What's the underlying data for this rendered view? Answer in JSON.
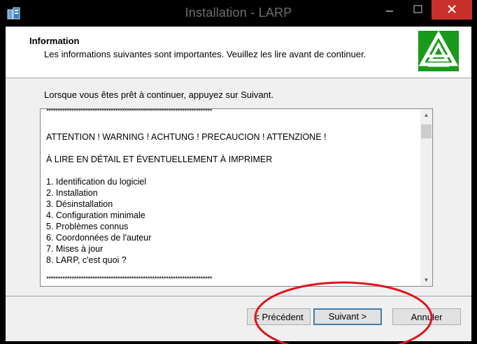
{
  "window": {
    "title": "Installation - LARP"
  },
  "header": {
    "title": "Information",
    "subtitle": "Les informations suivantes sont importantes. Veuillez les lire avant de continuer."
  },
  "body": {
    "instruction": "Lorsque vous êtes prêt à continuer, appuyez sur Suivant."
  },
  "memo": {
    "lines": [
      "************************************************************************",
      "",
      "ATTENTION ! WARNING ! ACHTUNG ! PRECAUCION ! ATTENZIONE !",
      "",
      "À LIRE EN DÉTAIL ET ÉVENTUELLEMENT À IMPRIMER",
      "",
      "1. Identification du logiciel",
      "2. Installation",
      "3. Désinstallation",
      "4. Configuration minimale",
      "5. Problèmes connus",
      "6. Coordonnées de l'auteur",
      "7. Mises à jour",
      "8. LARP, c'est quoi ?",
      "",
      "************************************************************************"
    ]
  },
  "buttons": {
    "previous": "< Précédent",
    "next": "Suivant >",
    "cancel": "Annuler"
  },
  "colors": {
    "close_button": "#c7302b",
    "logo_green": "#1a9a1a",
    "annotation_circle": "#e0141e"
  }
}
